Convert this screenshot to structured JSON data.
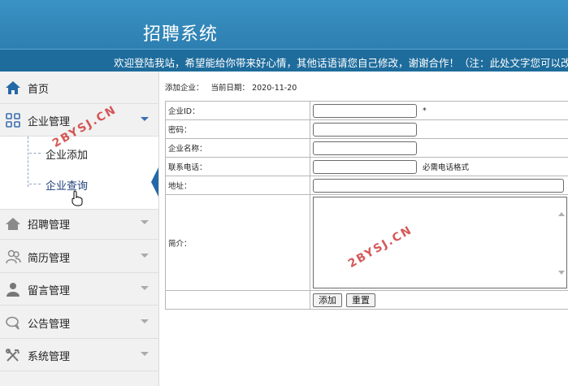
{
  "header": {
    "title": "招聘系统",
    "marquee": "欢迎登陆我站，希望能给你带来好心情，其他话语请您自己修改，谢谢合作！（注：此处文字您可以改"
  },
  "sidebar": {
    "items": [
      {
        "label": "首页",
        "icon": "home-icon"
      },
      {
        "label": "企业管理",
        "icon": "grid-icon"
      },
      {
        "label": "招聘管理",
        "icon": "house-icon"
      },
      {
        "label": "简历管理",
        "icon": "users-icon"
      },
      {
        "label": "留言管理",
        "icon": "user-icon"
      },
      {
        "label": "公告管理",
        "icon": "chat-icon"
      },
      {
        "label": "系统管理",
        "icon": "tools-icon"
      }
    ],
    "submenu": [
      {
        "label": "企业添加"
      },
      {
        "label": "企业查询"
      }
    ]
  },
  "main": {
    "breadcrumb": "添加企业：",
    "date_label": "当前日期：",
    "date": "2020-11-20",
    "form": {
      "fields": [
        {
          "label": "企业ID：",
          "value": "",
          "hint": "*"
        },
        {
          "label": "密码：",
          "value": ""
        },
        {
          "label": "企业名称：",
          "value": ""
        },
        {
          "label": "联系电话：",
          "value": "",
          "hint": "必需电话格式"
        },
        {
          "label": "地址：",
          "value": ""
        },
        {
          "label": "简介：",
          "value": ""
        }
      ],
      "submit_label": "添加",
      "reset_label": "重置"
    }
  },
  "watermark": "2BYSJ.CN",
  "colors": {
    "header": "#2f86b8",
    "marquee_bar": "#1e6c9c",
    "active_indicator": "#2368a8",
    "watermark": "#cf3b3b"
  }
}
